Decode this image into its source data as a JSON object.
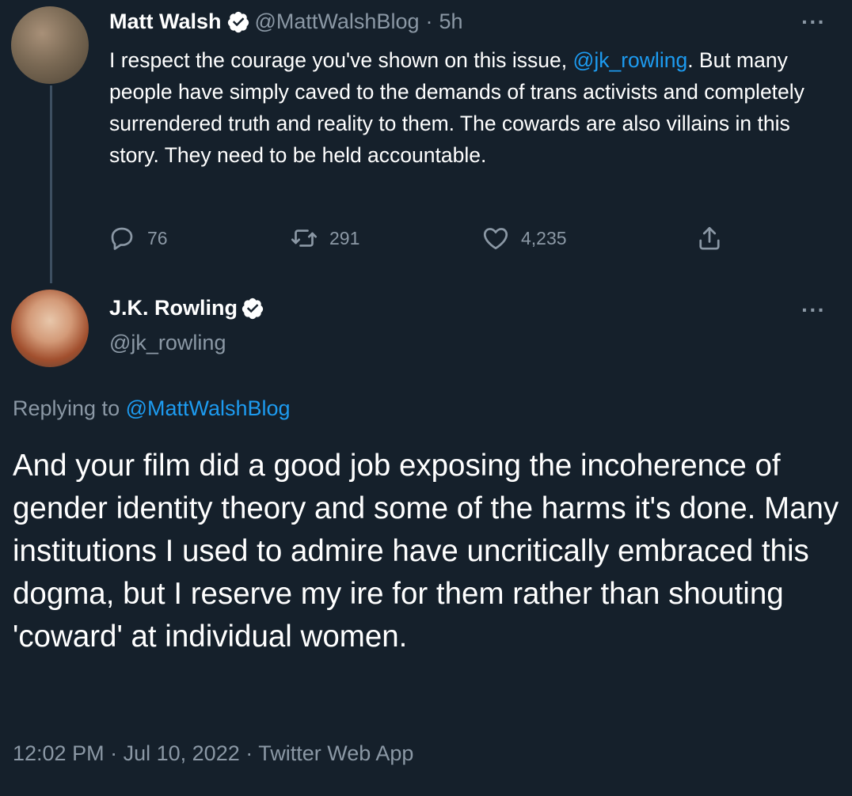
{
  "tweet1": {
    "name": "Matt Walsh",
    "handle": "@MattWalshBlog",
    "separator": "·",
    "time": "5h",
    "text_before_mention": "I respect the courage you've shown on this issue, ",
    "mention": "@jk_rowling",
    "text_after_mention": ". But many people have simply caved to the demands of trans activists and completely surrendered truth and reality to them. The cowards are also villains in this story. They need to be held accountable.",
    "more_label": "···",
    "actions": {
      "replies": "76",
      "retweets": "291",
      "likes": "4,235"
    }
  },
  "tweet2": {
    "name": "J.K. Rowling",
    "handle": "@jk_rowling",
    "more_label": "···",
    "replying_prefix": "Replying to ",
    "replying_handle": "@MattWalshBlog",
    "text": "And your film did a good job exposing the incoherence of gender identity theory and some of the harms it's done. Many institutions I used to admire have uncritically embraced this dogma, but I reserve my ire for them rather than shouting 'coward' at individual women.",
    "time": "12:02 PM",
    "date": "Jul 10, 2022",
    "source": "Twitter Web App",
    "meta_separator": "·"
  },
  "icons": {
    "reply": "reply-icon",
    "retweet": "retweet-icon",
    "like": "heart-icon",
    "share": "share-icon",
    "verified": "verified-badge-icon"
  },
  "colors": {
    "background": "#15202b",
    "text": "#ffffff",
    "secondary": "#8b98a5",
    "link": "#1d9bf0",
    "thread_line": "#3d4f61"
  }
}
